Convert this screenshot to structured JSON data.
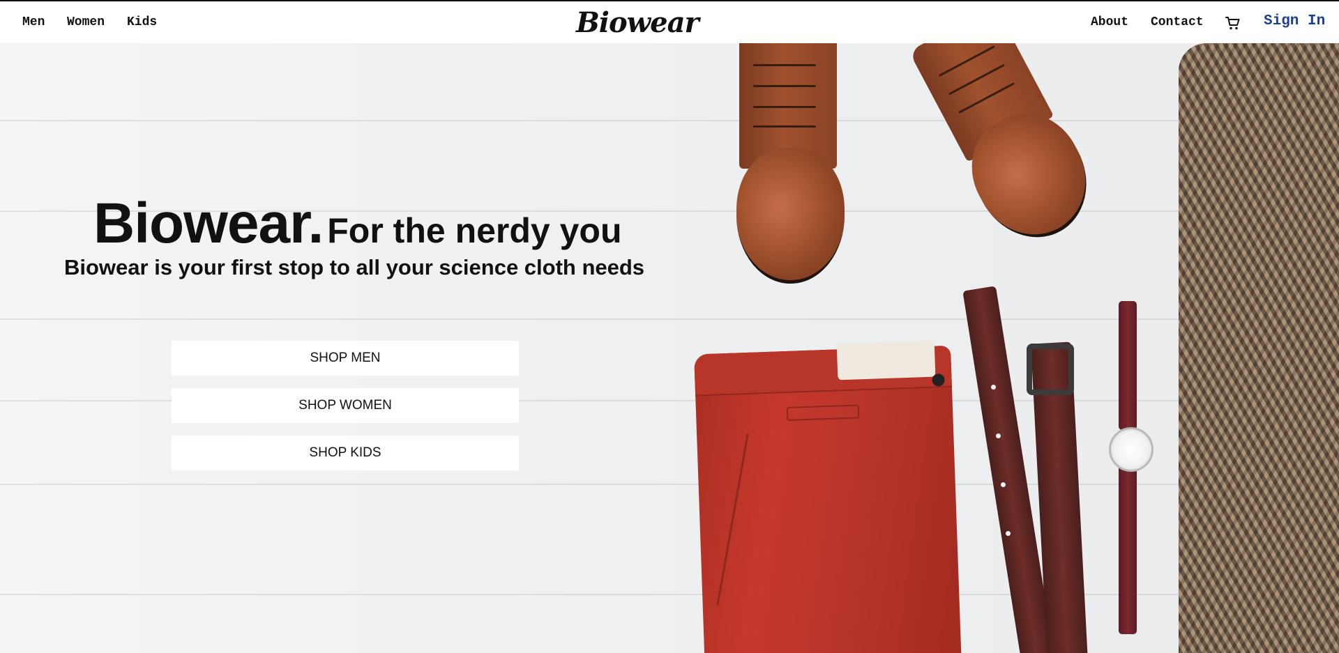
{
  "nav": {
    "left_links": [
      "Men",
      "Women",
      "Kids"
    ],
    "brand": "Biowear",
    "right_links": [
      "About",
      "Contact"
    ],
    "cart_icon": "shopping-cart-icon",
    "sign_in": "Sign In",
    "sign_in_color": "#1d3f93"
  },
  "hero": {
    "brand": "Biowear.",
    "tagline": "For the nerdy you",
    "subtitle": "Biowear is your first stop to all your science cloth needs",
    "buttons": [
      "SHOP MEN",
      "SHOP WOMEN",
      "SHOP KIDS"
    ]
  }
}
